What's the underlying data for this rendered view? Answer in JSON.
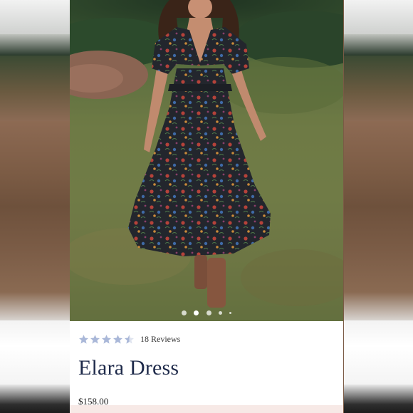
{
  "product": {
    "title": "Elara Dress",
    "price": "$158.00",
    "reviews_text": "18 Reviews",
    "rating": 4.5,
    "rating_max": 5,
    "star_color": "#a9b7d8"
  },
  "carousel": {
    "total_slides": 5,
    "active_index": 1
  }
}
